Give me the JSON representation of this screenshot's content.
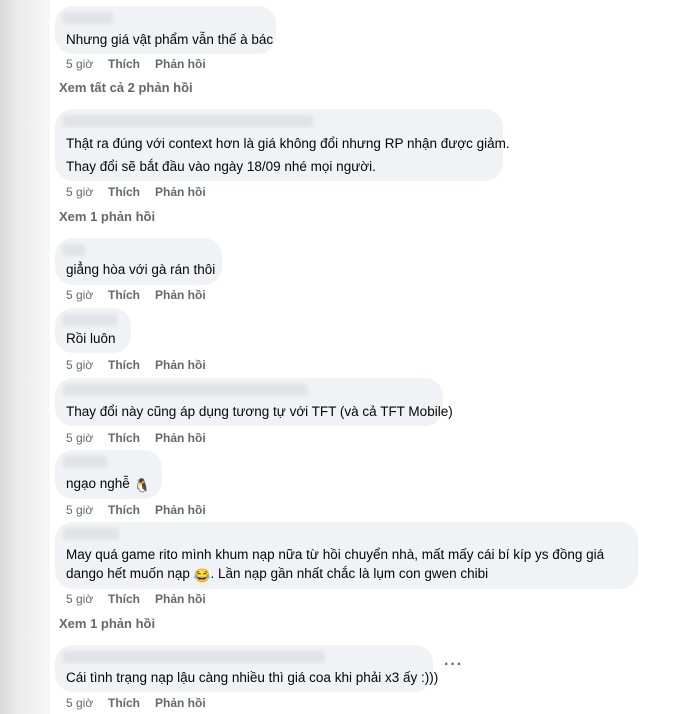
{
  "comments": [
    {
      "text_lines": [
        "Nhưng giá vật phẩm vẫn thế à bác"
      ],
      "time": "5 giờ",
      "like": "Thích",
      "reply": "Phản hồi"
    },
    {
      "text_lines": [
        "Thật ra đúng với context hơn là giá không đổi nhưng RP nhận được giảm.",
        "Thay đổi sẽ bắt đầu vào ngày 18/09 nhé mọi người."
      ],
      "time": "5 giờ",
      "like": "Thích",
      "reply": "Phản hồi"
    },
    {
      "text_lines": [
        "giẳng hòa với gà rán thôi"
      ],
      "time": "5 giờ",
      "like": "Thích",
      "reply": "Phản hồi"
    },
    {
      "text_lines": [
        "Rồi luôn"
      ],
      "time": "5 giờ",
      "like": "Thích",
      "reply": "Phản hồi"
    },
    {
      "text_lines": [
        "Thay đổi này cũng áp dụng tương tự với TFT (và cả TFT Mobile)"
      ],
      "time": "5 giờ",
      "like": "Thích",
      "reply": "Phản hồi"
    },
    {
      "text_lines": [
        "ngạo nghễ"
      ],
      "emoji": "🐧",
      "emoji_icon": "penguin-emoji",
      "time": "5 giờ",
      "like": "Thích",
      "reply": "Phản hồi"
    },
    {
      "text_lines": [
        "May quá game rito mình khum nạp nữa từ hồi chuyển nhà, mất mấy cái bí kíp ys đồng giá",
        "dango hết muốn nạp",
        ". Lần nạp gần nhất chắc là lụm con gwen chibi"
      ],
      "emoji": "😂",
      "emoji_icon": "laughing-emoji",
      "time": "5 giờ",
      "like": "Thích",
      "reply": "Phản hồi"
    },
    {
      "text_lines": [
        "Cái tình trạng nạp lậu càng nhiều thì giá coa khi phải x3 ấy :)))"
      ],
      "time": "5 giờ",
      "like": "Thích",
      "reply": "Phản hồi"
    }
  ],
  "view_replies": [
    "Xem tất cả 2 phản hồi",
    "Xem 1 phản hồi",
    "Xem 1 phản hồi"
  ],
  "more_menu": "···",
  "colors": {
    "bubble": "#f0f2f5",
    "meta": "#65676b",
    "text": "#050505"
  }
}
